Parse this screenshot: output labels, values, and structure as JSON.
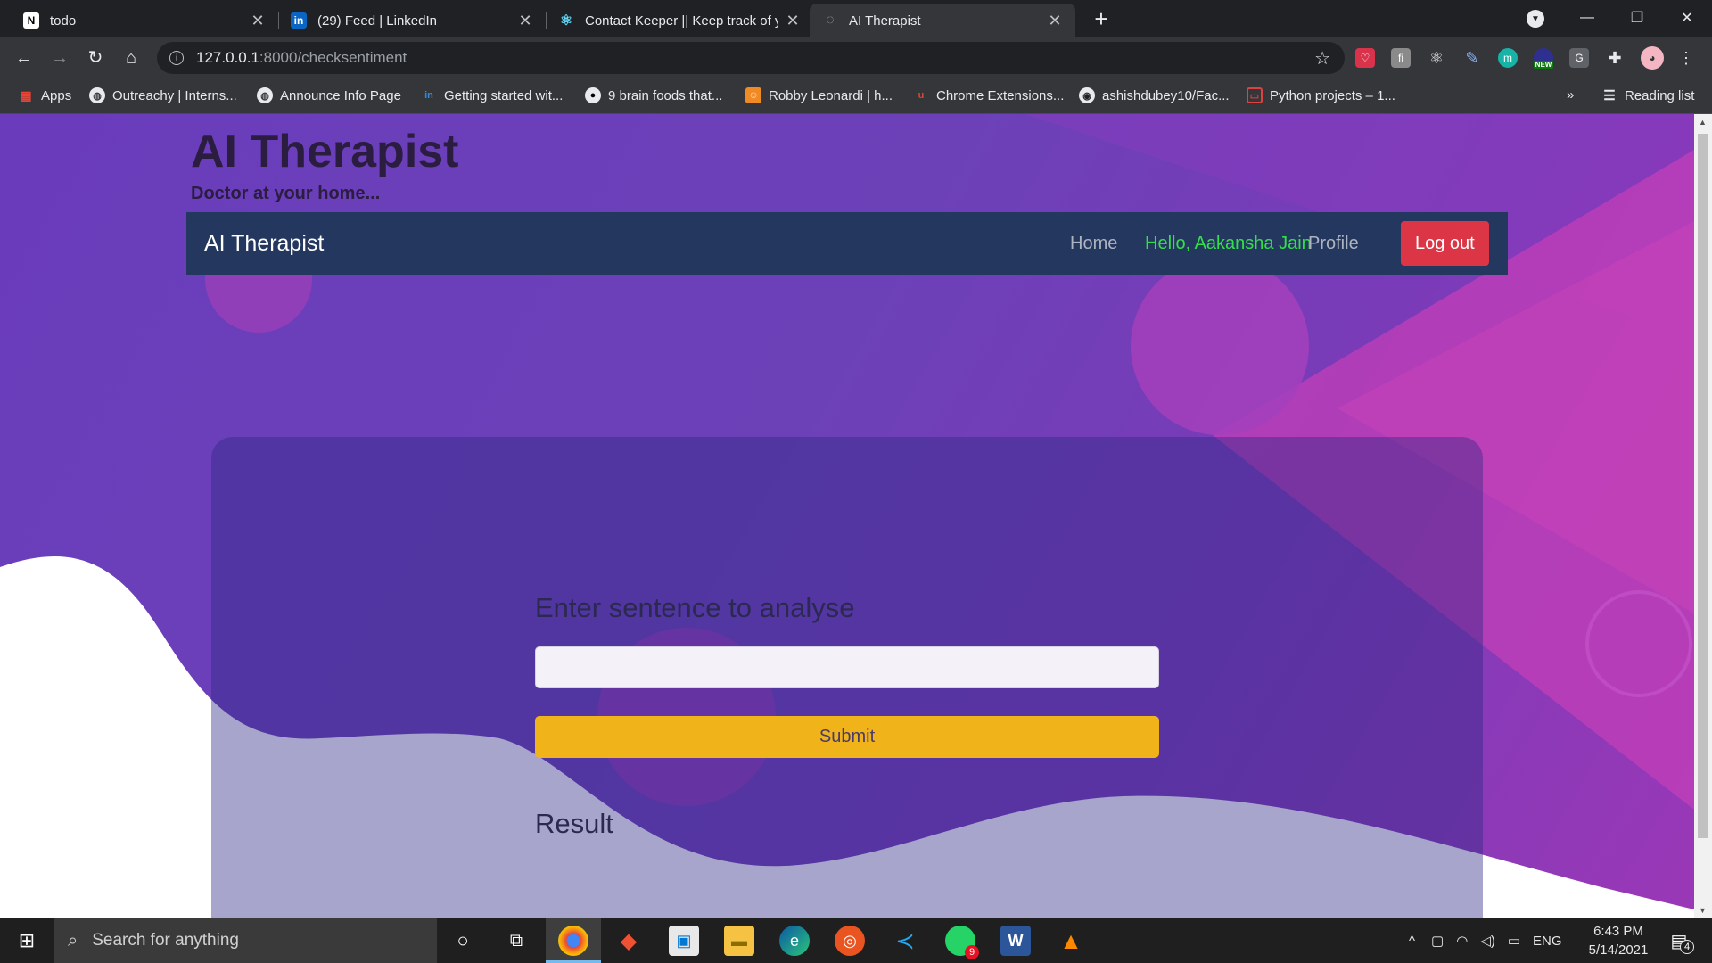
{
  "browser": {
    "tabs": [
      {
        "title": "todo",
        "favicon": "N"
      },
      {
        "title": "(29) Feed | LinkedIn",
        "favicon": "in"
      },
      {
        "title": "Contact Keeper || Keep track of yo",
        "favicon": "⚛"
      },
      {
        "title": "AI Therapist",
        "favicon": "◌"
      }
    ],
    "url_host": "127.0.0.1",
    "url_rest": ":8000/checksentiment",
    "ext_new_badge": "NEW",
    "bookmarks": [
      "Apps",
      "Outreachy | Interns...",
      "Announce Info Page",
      "Getting started wit...",
      "9 brain foods that...",
      "Robby Leonardi | h...",
      "Chrome Extensions...",
      "ashishdubey10/Fac...",
      "Python projects – 1..."
    ],
    "bookmarks_overflow": "»",
    "reading_list": "Reading list"
  },
  "site": {
    "title": "AI Therapist",
    "tagline": "Doctor at your home...",
    "navbar": {
      "brand": "AI Therapist",
      "home": "Home",
      "user_greeting": "Hello, Aakansha Jain",
      "profile": "Profile",
      "logout": "Log out"
    },
    "form": {
      "heading": "Enter sentence to analyse",
      "input_value": "",
      "submit": "Submit",
      "result_heading": "Result"
    },
    "colors": {
      "navbar": "#24375f",
      "logout": "#dc3545",
      "submit": "#f0b31a",
      "user_greeting": "#34e04a"
    }
  },
  "taskbar": {
    "search_placeholder": "Search for anything",
    "whatsapp_badge": "9",
    "language": "ENG",
    "time": "6:43 PM",
    "date": "5/14/2021",
    "notifications": "4"
  }
}
